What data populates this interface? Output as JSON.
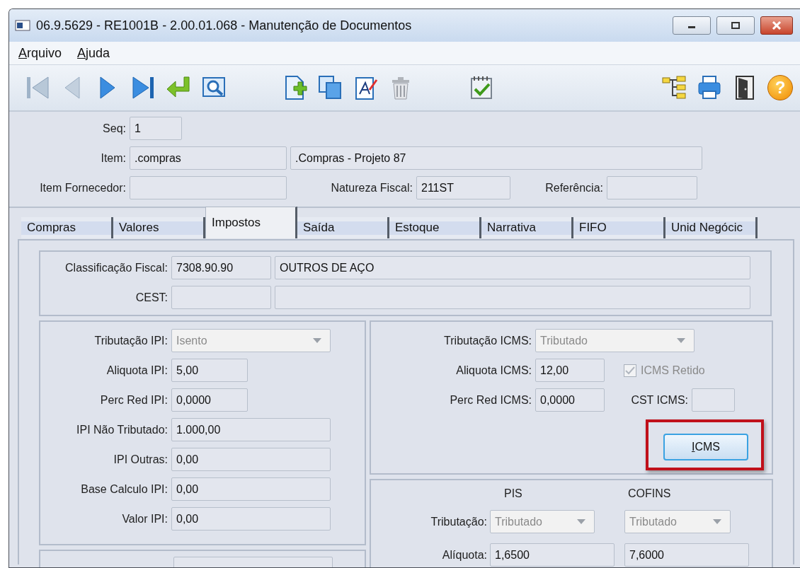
{
  "window": {
    "title": "06.9.5629 - RE1001B - 2.00.01.068 - Manutenção de Documentos"
  },
  "menu": [
    {
      "label": "Arquivo"
    },
    {
      "label": "Ajuda"
    }
  ],
  "toolbar": {
    "help_glyph": "?"
  },
  "header": {
    "seq": {
      "label": "Seq:",
      "value": "1"
    },
    "item": {
      "label": "Item:",
      "value": ".compras",
      "description": ".Compras - Projeto 87"
    },
    "item_fornecedor": {
      "label": "Item Fornecedor:"
    },
    "natureza_fiscal": {
      "label": "Natureza Fiscal:",
      "value": "211ST"
    },
    "referencia": {
      "label": "Referência:"
    }
  },
  "tabs": [
    {
      "label": "Compras",
      "selected": false
    },
    {
      "label": "Valores",
      "selected": false
    },
    {
      "label": "Impostos",
      "selected": true
    },
    {
      "label": "Saída",
      "selected": false
    },
    {
      "label": "Estoque",
      "selected": false
    },
    {
      "label": "Narrativa",
      "selected": false
    },
    {
      "label": "FIFO",
      "selected": false
    },
    {
      "label": "Unid Negócic",
      "selected": false
    }
  ],
  "classificacao": {
    "classificacao_fiscal": {
      "label": "Classificação Fiscal:",
      "value": "7308.90.90",
      "description": "OUTROS DE AÇO"
    },
    "cest": {
      "label": "CEST:"
    }
  },
  "ipi": {
    "fields": [
      {
        "kind": "select",
        "label": "Tributação IPI:",
        "value": "Isento",
        "disabled": true
      },
      {
        "kind": "rate",
        "label": "Aliquota IPI:",
        "value": "5,00"
      },
      {
        "kind": "rate",
        "label": "Perc Red IPI:",
        "value": "0,0000"
      },
      {
        "kind": "amount",
        "label": "IPI Não Tributado:",
        "value": "1.000,00"
      },
      {
        "kind": "amount",
        "label": "IPI Outras:",
        "value": "0,00"
      },
      {
        "kind": "amount",
        "label": "Base Calculo IPI:",
        "value": "0,00"
      },
      {
        "kind": "amount",
        "label": "Valor IPI:",
        "value": "0,00"
      }
    ]
  },
  "icms": {
    "tributacao": {
      "label": "Tributação ICMS:",
      "value": "Tributado",
      "disabled": true
    },
    "aliquota": {
      "label": "Aliquota ICMS:",
      "value": "12,00"
    },
    "retido": {
      "label": "ICMS Retido",
      "checked": true,
      "disabled": true
    },
    "perc_red": {
      "label": "Perc Red ICMS:",
      "value": "0,0000"
    },
    "cst": {
      "label": "CST ICMS:"
    },
    "button": {
      "label": "ICMS",
      "highlighted": true
    }
  },
  "pis_cofins": {
    "columns": [
      "PIS",
      "COFINS"
    ],
    "tributacao": {
      "label": "Tributação:",
      "values": [
        "Tributado",
        "Tributado"
      ],
      "disabled": true
    },
    "aliquota": {
      "label": "Alíquota:",
      "values": [
        "1,6500",
        "7,6000"
      ]
    }
  }
}
